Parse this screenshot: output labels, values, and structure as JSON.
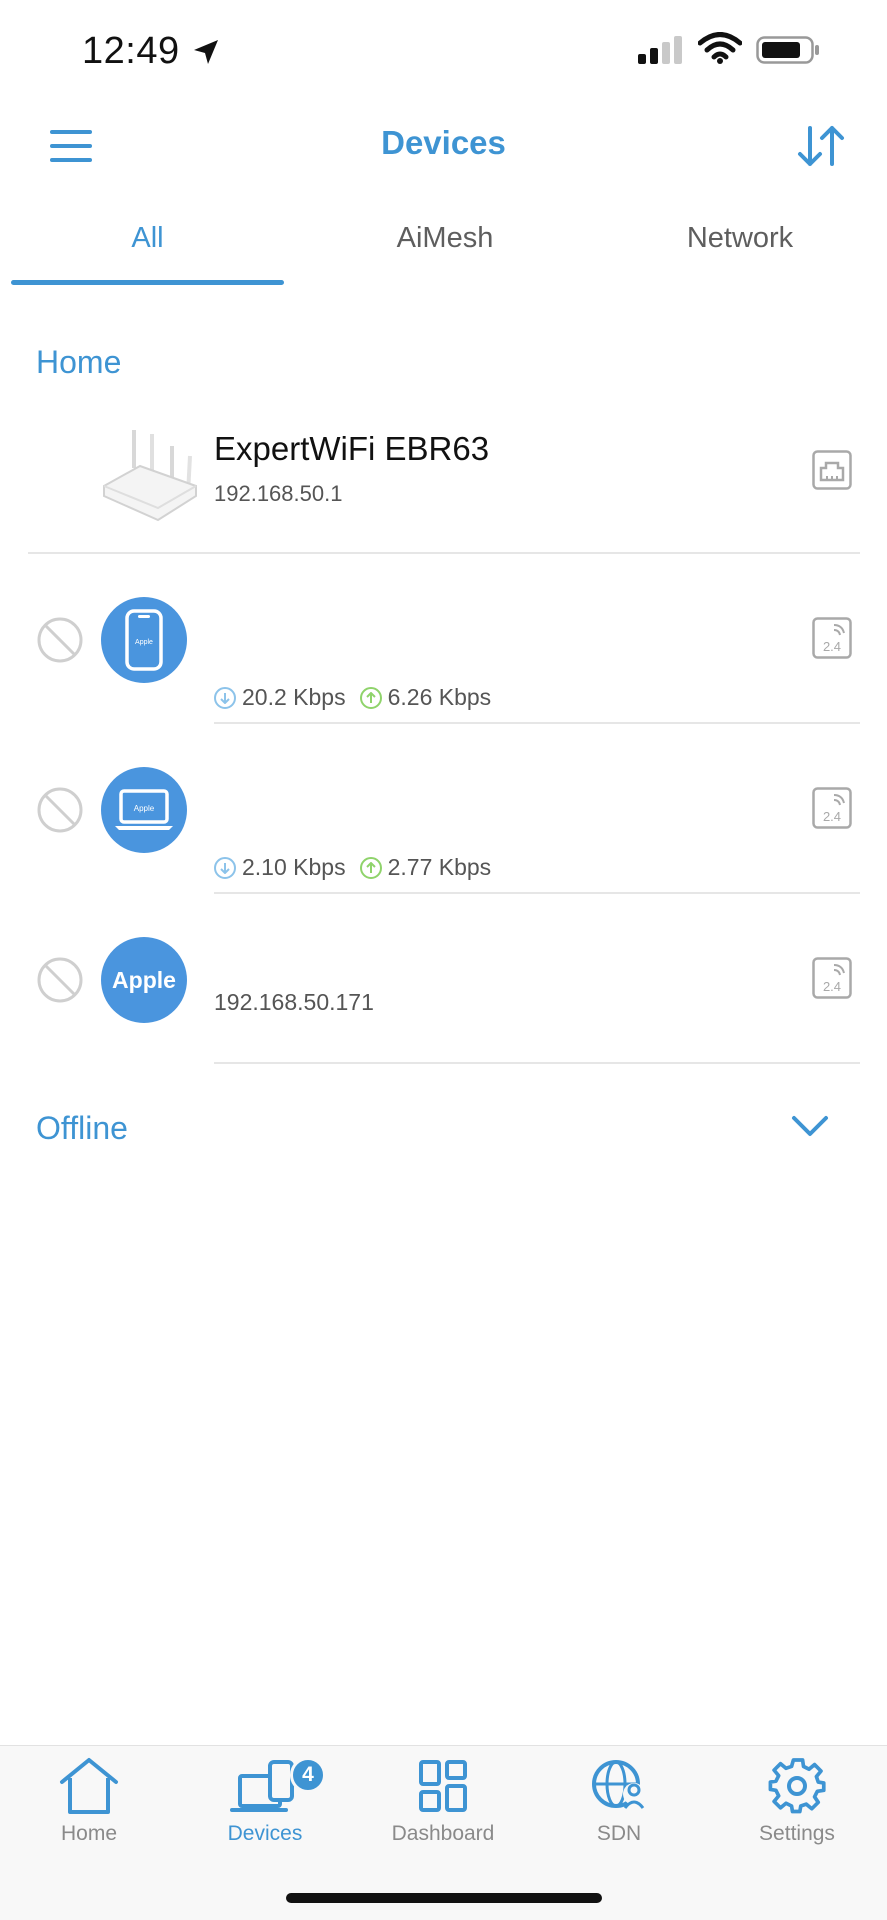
{
  "status_bar": {
    "time": "12:49"
  },
  "header": {
    "title": "Devices"
  },
  "tabs": [
    {
      "label": "All",
      "active": true
    },
    {
      "label": "AiMesh",
      "active": false
    },
    {
      "label": "Network",
      "active": false
    }
  ],
  "sections": {
    "home_label": "Home",
    "offline_label": "Offline"
  },
  "router": {
    "name": "ExpertWiFi EBR63",
    "ip": "192.168.50.1",
    "connection_icon": "ethernet-icon"
  },
  "clients": [
    {
      "avatar": "iphone-icon",
      "avatar_text": "Apple",
      "download": "20.2 Kbps",
      "upload": "6.26 Kbps",
      "band": "2.4"
    },
    {
      "avatar": "laptop-icon",
      "avatar_text": "Apple",
      "download": "2.10 Kbps",
      "upload": "2.77 Kbps",
      "band": "2.4"
    },
    {
      "avatar": "apple-text",
      "avatar_text": "Apple",
      "ip": "192.168.50.171",
      "band": "2.4"
    }
  ],
  "bottom_nav": {
    "items": [
      {
        "label": "Home",
        "icon": "home-icon",
        "active": false
      },
      {
        "label": "Devices",
        "icon": "devices-icon",
        "active": true,
        "badge": "4"
      },
      {
        "label": "Dashboard",
        "icon": "dashboard-icon",
        "active": false
      },
      {
        "label": "SDN",
        "icon": "sdn-icon",
        "active": false
      },
      {
        "label": "Settings",
        "icon": "gear-icon",
        "active": false
      }
    ]
  },
  "colors": {
    "accent": "#3e94d3",
    "avatar": "#4a95de",
    "download": "#8cc3ea",
    "upload": "#8fd36b"
  }
}
